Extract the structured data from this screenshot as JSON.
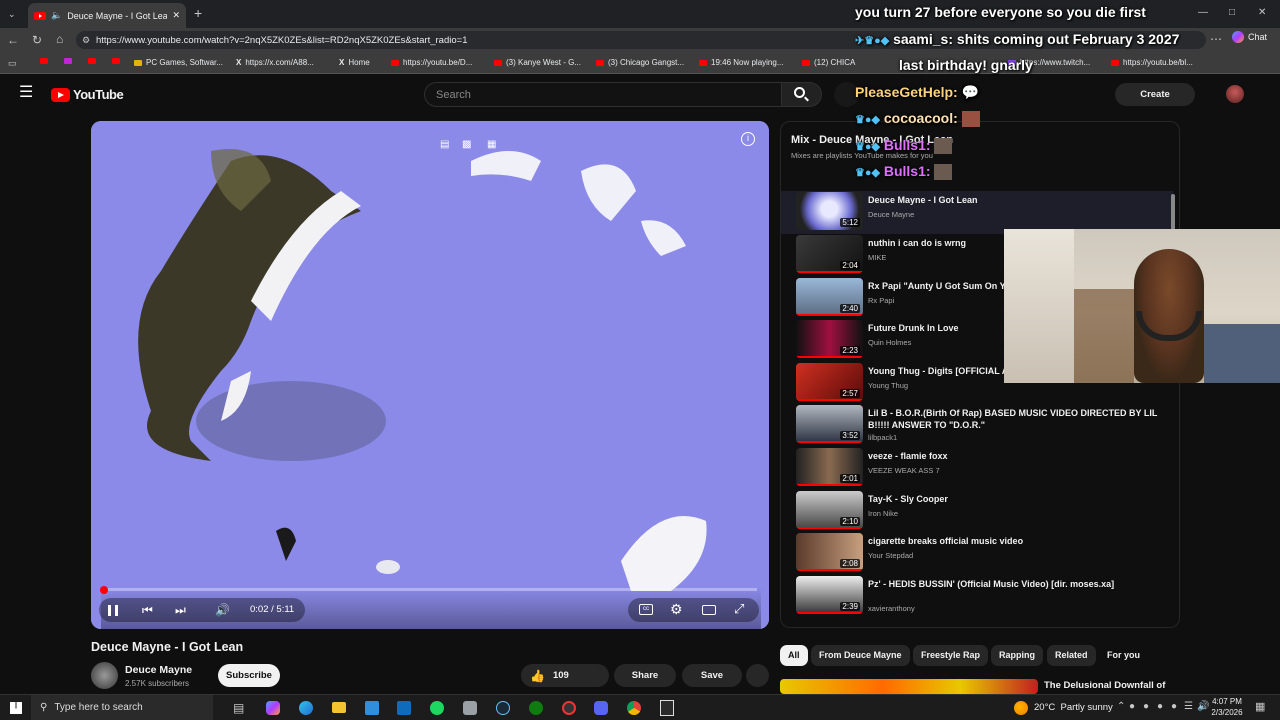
{
  "browser": {
    "tab_title": "Deuce Mayne - I Got Lean - Yo",
    "url": "https://www.youtube.com/watch?v=2nqX5ZK0ZEs&list=RD2nqX5ZK0ZEs&start_radio=1",
    "chat_button": "Chat",
    "bookmarks": [
      "PC Games, Softwar...",
      "https://x.com/A88...",
      "Home",
      "https://youtu.be/D...",
      "(3) Kanye West - G...",
      "(3) Chicago Gangst...",
      "19:46 Now playing...",
      "(12) CHICA",
      "https://www.twitch...",
      "https://youtu.be/bl..."
    ]
  },
  "youtube": {
    "logo": "YouTube",
    "search_placeholder": "Search",
    "create_label": "Create"
  },
  "player": {
    "time": "0:02 / 5:11",
    "progress_fraction": 0.006
  },
  "video": {
    "title": "Deuce Mayne - I Got Lean",
    "channel": "Deuce Mayne",
    "subscribers": "2.57K subscribers",
    "subscribe_label": "Subscribe",
    "likes": "109",
    "share_label": "Share",
    "save_label": "Save"
  },
  "playlist": {
    "title": "Mix - Deuce Mayne - I Got Lean",
    "subtitle": "Mixes are playlists YouTube makes for you",
    "items": [
      {
        "title": "Deuce Mayne - I Got Lean",
        "channel": "Deuce Mayne",
        "duration": "5:12"
      },
      {
        "title": "nuthin i can do is wrng",
        "channel": "MIKE",
        "duration": "2:04"
      },
      {
        "title": "Rx Papi \"Aunty U Got Sum On Ya",
        "channel": "Rx Papi",
        "duration": "2:40"
      },
      {
        "title": "Future Drunk In Love",
        "channel": "Quin Holmes",
        "duration": "2:23"
      },
      {
        "title": "Young Thug - Digits [OFFICIAL AI",
        "channel": "Young Thug",
        "duration": "2:57"
      },
      {
        "title": "Lil B - B.O.R.(Birth Of Rap) BASED MUSIC VIDEO DIRECTED BY LIL B!!!!! ANSWER TO \"D.O.R.\"",
        "channel": "lilbpack1",
        "duration": "3:52"
      },
      {
        "title": "veeze - flamie foxx",
        "channel": "VEEZE WEAK ASS 7",
        "duration": "2:01"
      },
      {
        "title": "Tay-K - Sly Cooper",
        "channel": "Iron Nike",
        "duration": "2:10"
      },
      {
        "title": "cigarette breaks official music video",
        "channel": "Your Stepdad",
        "duration": "2:08"
      },
      {
        "title": "Pz' - HEDIS BUSSIN' (Official Music Video) [dir. moses.xa]",
        "channel": "xavieranthony",
        "duration": "2:39"
      }
    ]
  },
  "chips": [
    "All",
    "From Deuce Mayne",
    "Freestyle Rap",
    "Rapping",
    "Related",
    "For you"
  ],
  "recommended": {
    "title": "The Delusional Downfall of"
  },
  "stream_overlay": {
    "banner": "you turn 27 before everyone so you die first",
    "messages": [
      {
        "user": "saami_s:",
        "text": "shits coming out February 3 2027"
      },
      {
        "user": "",
        "text": "last birthday! gnarly"
      },
      {
        "user": "PleaseGetHelp:",
        "text": ""
      },
      {
        "user": "cocoacool:",
        "text": ""
      },
      {
        "user": "Bulls1:",
        "text": ""
      },
      {
        "user": "Bulls1:",
        "text": ""
      }
    ]
  },
  "taskbar": {
    "search_placeholder": "Type here to search",
    "weather": "20°C  Partly sunny",
    "time": "4:07 PM",
    "date": "2/3/2026"
  }
}
